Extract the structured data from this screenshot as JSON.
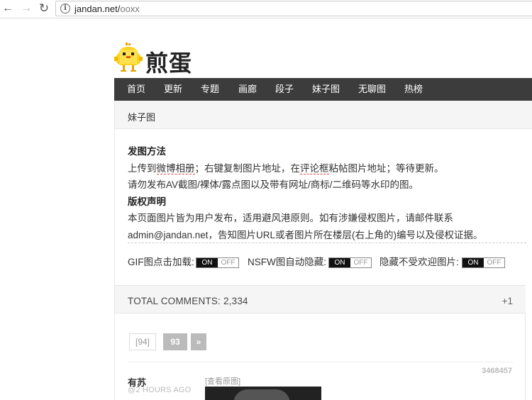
{
  "browser": {
    "url_domain": "jandan.net/",
    "url_path": "ooxx",
    "back_icon": "←",
    "forward_icon": "→",
    "reload_icon": "↻",
    "info_icon": "i"
  },
  "logo": {
    "text": "煎蛋"
  },
  "nav": {
    "items": [
      {
        "label": "首页"
      },
      {
        "label": "更新"
      },
      {
        "label": "专题"
      },
      {
        "label": "画廊"
      },
      {
        "label": "段子"
      },
      {
        "label": "妹子图"
      },
      {
        "label": "无聊图"
      },
      {
        "label": "热榜"
      }
    ]
  },
  "breadcrumb": "妹子图",
  "info": {
    "heading1": "发图方法",
    "line1_a": "上传到",
    "line1_b": "微博相册",
    "line1_c": "；右键复制图片地址，在",
    "line1_d": "评论框",
    "line1_e": "粘帖图片地址；等待更新。",
    "line2": "请勿发布AV截图/裸体/露点图以及带有网址/商标/二维码等水印的图。",
    "heading2": "版权声明",
    "line3": "本页面图片皆为用户发布，适用避风港原则。如有涉嫌侵权图片，请邮件联系",
    "line4": "admin@jandan.net，告知图片URL或者图片所在楼层(右上角的)编号以及侵权证据。"
  },
  "toggles": [
    {
      "label": "GIF图点击加载:",
      "on": "ON",
      "off": "OFF"
    },
    {
      "label": "NSFW图自动隐藏:",
      "on": "ON",
      "off": "OFF"
    },
    {
      "label": "隐藏不受欢迎图片:",
      "on": "ON",
      "off": "OFF"
    }
  ],
  "comments": {
    "total": "TOTAL COMMENTS: 2,334",
    "plus_one": "+1"
  },
  "pager": {
    "current": "[94]",
    "next_page": "93",
    "next_arrow": "»"
  },
  "post": {
    "id": "3468457",
    "author": "有苏",
    "time": "@2 HOURS AGO",
    "view_original": "[查看原图]"
  },
  "colors": {
    "nav_bg": "#3c3c3c",
    "panel_bg": "#f5f5f5",
    "pager_bg": "#bbbbbb"
  }
}
